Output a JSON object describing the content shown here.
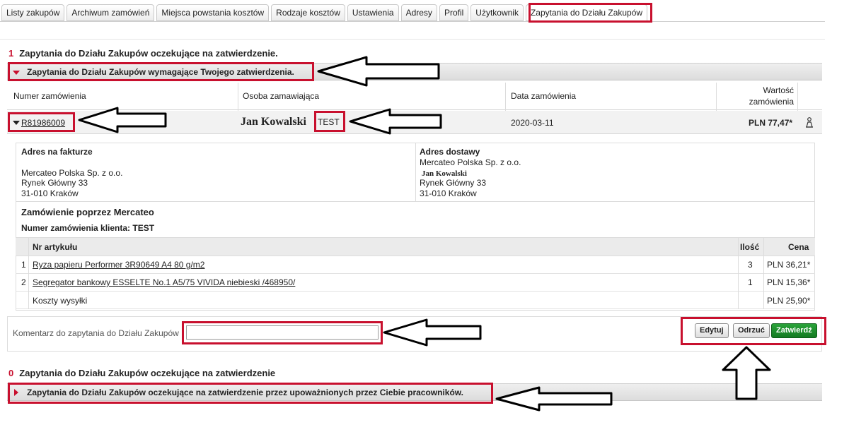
{
  "tabs": [
    {
      "label": "Listy zakupów"
    },
    {
      "label": "Archiwum zamówień"
    },
    {
      "label": "Miejsca powstania kosztów"
    },
    {
      "label": "Rodzaje kosztów"
    },
    {
      "label": "Ustawienia"
    },
    {
      "label": "Adresy"
    },
    {
      "label": "Profil"
    },
    {
      "label": "Użytkownik"
    },
    {
      "label": "Zapytania do Działu Zakupów"
    }
  ],
  "section1": {
    "count": "1",
    "title": "Zapytania do Działu Zakupów oczekujące na zatwierdzenie.",
    "band_label": "Zapytania do Działu Zakupów wymagające Twojego zatwierdzenia."
  },
  "table": {
    "headers": {
      "order_number": "Numer zamówienia",
      "requester": "Osoba zamawiająca",
      "order_date": "Data zamówienia",
      "value_line1": "Wartość",
      "value_line2": "zamówienia"
    },
    "row": {
      "order_number": "R81986009",
      "requester_name": "Jan Kowalski",
      "requester_tag": "TEST",
      "date": "2020-03-11",
      "value": "PLN 77,47*"
    }
  },
  "details": {
    "billing_label": "Adres na fakturze",
    "billing": {
      "company": "Mercateo Polska Sp. z o.o.",
      "street": "Rynek Główny 33",
      "city": "31-010 Kraków"
    },
    "shipping_label": "Adres dostawy",
    "shipping": {
      "company": "Mercateo Polska Sp. z o.o.",
      "person": "Jan Kowalski",
      "street": "Rynek Główny 33",
      "city": "31-010 Kraków"
    },
    "order_via": "Zamówienie poprzez Mercateo",
    "client_order_number": "Numer zamówienia klienta: TEST",
    "items_headers": {
      "article": "Nr artykułu",
      "qty": "Ilość",
      "price": "Cena"
    },
    "items": [
      {
        "no": "1",
        "name": "Ryza papieru Performer 3R90649 A4 80 g/m2",
        "qty": "3",
        "price": "PLN 36,21*"
      },
      {
        "no": "2",
        "name": "Segregator bankowy ESSELTE No.1 A5/75 VIVIDA niebieski /468950/",
        "qty": "1",
        "price": "PLN 15,36*"
      }
    ],
    "shipping_cost_label": "Koszty wysyłki",
    "shipping_cost": "PLN 25,90*"
  },
  "comment": {
    "label": "Komentarz do zapytania do Działu Zakupów",
    "value": ""
  },
  "buttons": {
    "edit": "Edytuj",
    "reject": "Odrzuć",
    "approve": "Zatwierdź"
  },
  "section2": {
    "count": "0",
    "title": "Zapytania do Działu Zakupów oczekujące na zatwierdzenie",
    "band_label": "Zapytania do Działu Zakupów oczekujące na zatwierdzenie przez upoważnionych przez Ciebie pracowników."
  },
  "colors": {
    "accent_red": "#c8102e",
    "approve_green": "#1a8a2a"
  },
  "icons": {
    "row_icon": "user-icon",
    "arrow": "arrow-annotation"
  }
}
